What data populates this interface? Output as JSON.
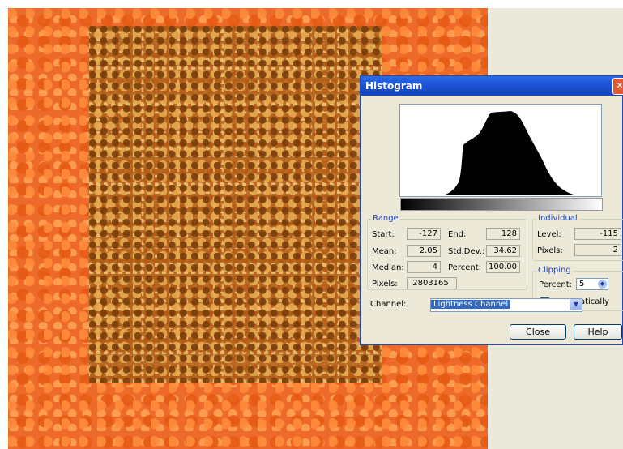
{
  "dialog": {
    "title": "Histogram",
    "range": {
      "legend": "Range",
      "start_label": "Start:",
      "start_value": "-127",
      "end_label": "End:",
      "end_value": "128",
      "mean_label": "Mean:",
      "mean_value": "2.05",
      "stddev_label": "Std.Dev.:",
      "stddev_value": "34.62",
      "median_label": "Median:",
      "median_value": "4",
      "percent_label": "Percent:",
      "percent_value": "100.00",
      "pixels_label": "Pixels:",
      "pixels_value": "2803165"
    },
    "individual": {
      "legend": "Individual",
      "level_label": "Level:",
      "level_value": "-115",
      "pixels_label": "Pixels:",
      "pixels_value": "2"
    },
    "clipping": {
      "legend": "Clipping",
      "percent_label": "Percent:",
      "percent_value": "5",
      "automatically_label": "Automatically"
    },
    "channel_label": "Channel:",
    "channel_selected": "Lightness Channel",
    "buttons": {
      "close": "Close",
      "help": "Help"
    }
  },
  "icons": {
    "close": "close-icon",
    "dropdown": "chevron-down-icon",
    "spin": "spin-icon"
  },
  "colors": {
    "titlebar": "#1a4fd0",
    "legend_text": "#2044c8",
    "selection_highlight": "#316ac5"
  }
}
